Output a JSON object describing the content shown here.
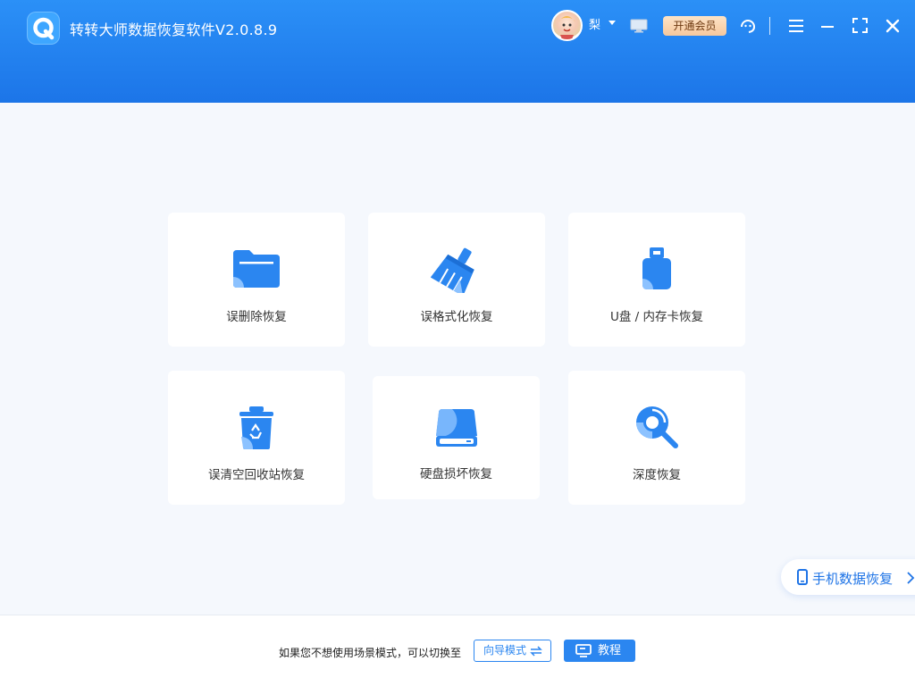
{
  "app": {
    "title": "转转大师数据恢复软件V2.0.8.9"
  },
  "header": {
    "username": "梨",
    "vip_label": "开通会员"
  },
  "colors": {
    "primary": "#1f7ce9",
    "header_top": "#2b90f7",
    "background": "#f5f8fd",
    "vip_bg": "#f9d4ae"
  },
  "cards": [
    {
      "label": "误删除恢复",
      "icon": "folder-icon"
    },
    {
      "label": "误格式化恢复",
      "icon": "broom-icon"
    },
    {
      "label": "U盘 / 内存卡恢复",
      "icon": "usb-drive-icon"
    },
    {
      "label": "误清空回收站恢复",
      "icon": "recycle-bin-icon"
    },
    {
      "label": "硬盘损坏恢复",
      "icon": "hard-disk-icon"
    },
    {
      "label": "深度恢复",
      "icon": "deep-scan-icon"
    }
  ],
  "side": {
    "phone_recovery_label": "手机数据恢复"
  },
  "footer": {
    "hint": "如果您不想使用场景模式，可以切换至",
    "guide_mode": "向导模式",
    "tutorial": "教程"
  }
}
